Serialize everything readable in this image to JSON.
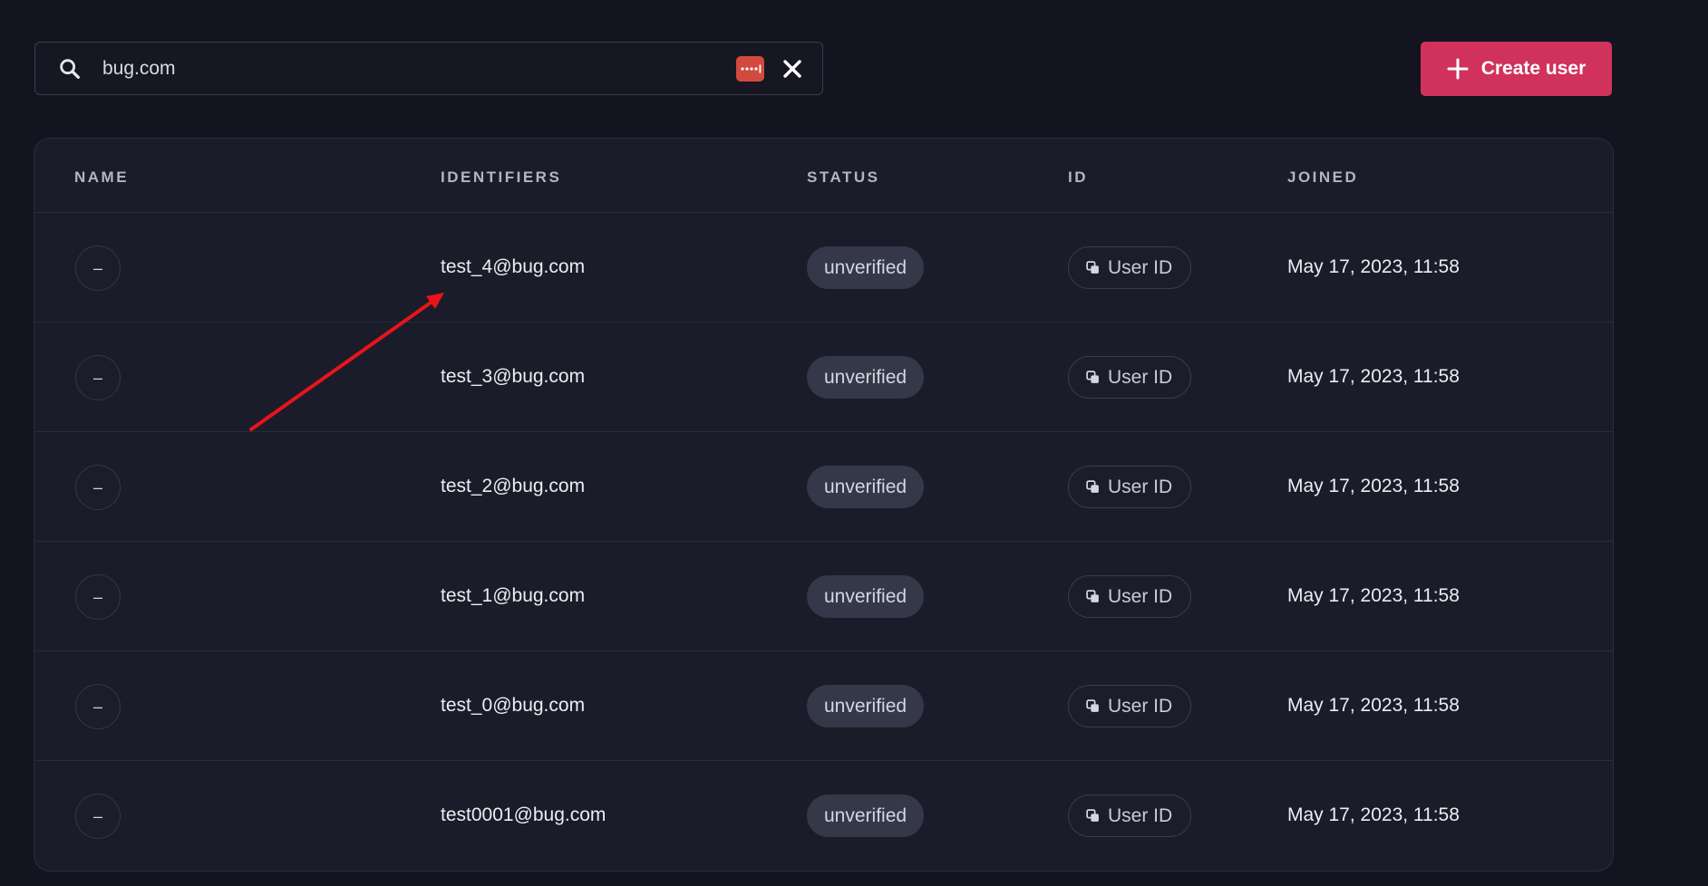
{
  "search": {
    "value": "bug.com",
    "icon": "search-icon",
    "password_manager_icon": "password-manager-icon",
    "clear_icon": "close-icon"
  },
  "create_button": {
    "label": "Create user",
    "icon": "plus-icon",
    "color": "#d0325c"
  },
  "table": {
    "columns": [
      "NAME",
      "IDENTIFIERS",
      "STATUS",
      "ID",
      "JOINED"
    ],
    "rows": [
      {
        "name": "–",
        "identifier": "test_4@bug.com",
        "status": "unverified",
        "id_label": "User ID",
        "joined": "May 17, 2023, 11:58"
      },
      {
        "name": "–",
        "identifier": "test_3@bug.com",
        "status": "unverified",
        "id_label": "User ID",
        "joined": "May 17, 2023, 11:58"
      },
      {
        "name": "–",
        "identifier": "test_2@bug.com",
        "status": "unverified",
        "id_label": "User ID",
        "joined": "May 17, 2023, 11:58"
      },
      {
        "name": "–",
        "identifier": "test_1@bug.com",
        "status": "unverified",
        "id_label": "User ID",
        "joined": "May 17, 2023, 11:58"
      },
      {
        "name": "–",
        "identifier": "test_0@bug.com",
        "status": "unverified",
        "id_label": "User ID",
        "joined": "May 17, 2023, 11:58"
      },
      {
        "name": "–",
        "identifier": "test0001@bug.com",
        "status": "unverified",
        "id_label": "User ID",
        "joined": "May 17, 2023, 11:58"
      }
    ]
  },
  "annotation": {
    "type": "arrow",
    "color": "#e8141b"
  }
}
